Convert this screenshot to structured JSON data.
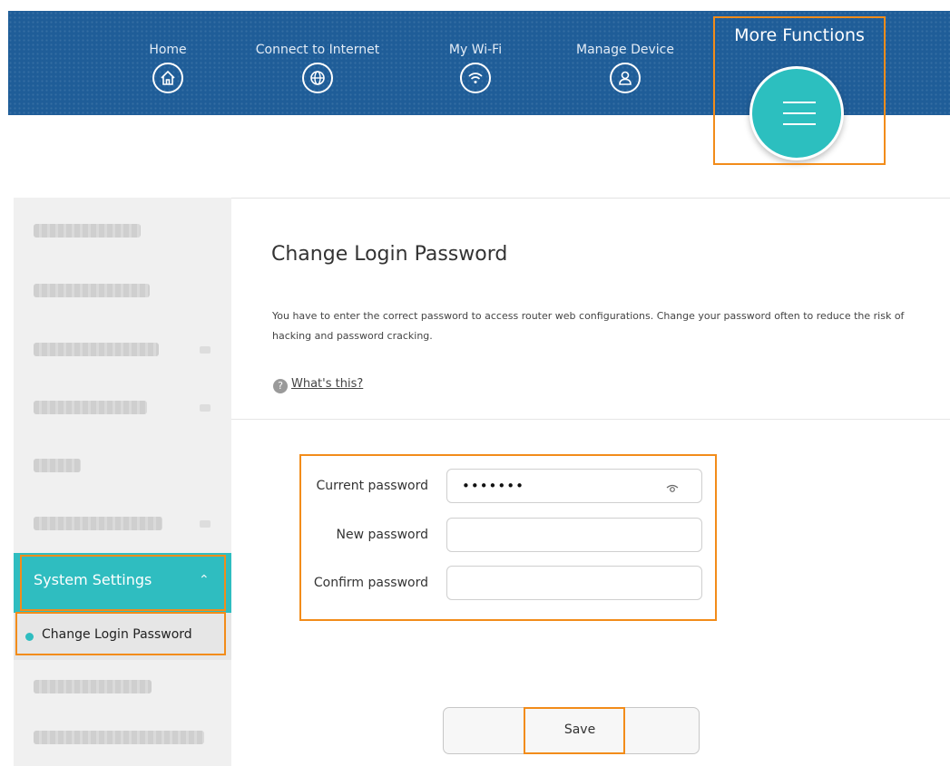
{
  "nav": {
    "home": "Home",
    "connect": "Connect to Internet",
    "wifi": "My Wi-Fi",
    "manage": "Manage Device",
    "more": "More Functions"
  },
  "sidebar": {
    "active_section": "System Settings",
    "active_item": "Change Login Password"
  },
  "main": {
    "title": "Change Login Password",
    "description": "You have to enter the correct password to access router web configurations. Change your password often to reduce the risk of hacking and password cracking.",
    "help_link": "What's this?",
    "help_icon": "?"
  },
  "form": {
    "current_label": "Current password",
    "current_value": "•••••••",
    "new_label": "New password",
    "new_value": "",
    "confirm_label": "Confirm password",
    "confirm_value": "",
    "save_label": "Save"
  },
  "colors": {
    "header": "#1f5d98",
    "accent": "#2fbdc0",
    "highlight": "#f28c1a"
  },
  "icons": [
    "home-icon",
    "globe-icon",
    "wifi-icon",
    "user-icon",
    "menu-icon",
    "eye-icon",
    "help-icon",
    "chevron-up-icon"
  ]
}
